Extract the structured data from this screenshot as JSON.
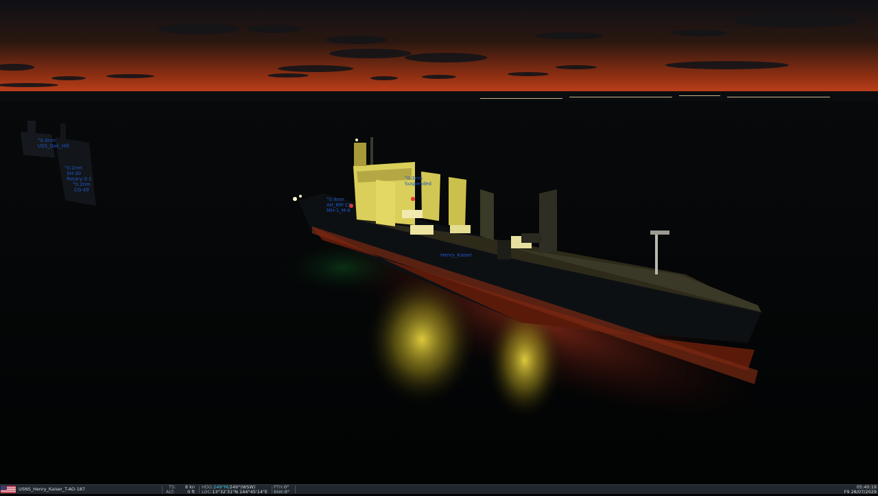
{
  "contacts": [
    {
      "range": "°0.4nm",
      "name": "USS_Oak_Hill"
    },
    {
      "range": "°0.2nm",
      "name": "SH-30"
    },
    {
      "range": "",
      "name": "Rotary-3-1"
    },
    {
      "range": "°0.2nm",
      "name": "CG-49"
    },
    {
      "range": "°0.4nm",
      "name": "AH_6M-13"
    },
    {
      "range": "",
      "name": "MH-1_M-6"
    },
    {
      "range": "°0.3nm",
      "name": "Suspended"
    },
    {
      "range": "",
      "name": "Henry_Kaiser"
    }
  ],
  "hud": {
    "vessel": "USNS_Henry_Kaiser_T-AO-187",
    "ts_label": "TS:",
    "ts_value": "8 kn",
    "alt_label": "ALT:",
    "alt_value": "0 ft",
    "hdg_label": "HDG:",
    "hdg_mag": "249°M/",
    "hdg_true": "249°(WSW)",
    "loc_label": "LOC:",
    "loc_value": "13°32'31\"N 144°45'14\"E",
    "pth_label": "PTH:",
    "pth_value": "0°",
    "bnk_label": "BNK:",
    "bnk_value": "0°",
    "time": "05:40:19",
    "date": "F9 28/07/2029"
  },
  "colors": {
    "contact_label": "#1f56c9",
    "hud_bg": "#22272d",
    "hud_accent": "#3bd0e8",
    "sky_glow": "#c0401a"
  }
}
